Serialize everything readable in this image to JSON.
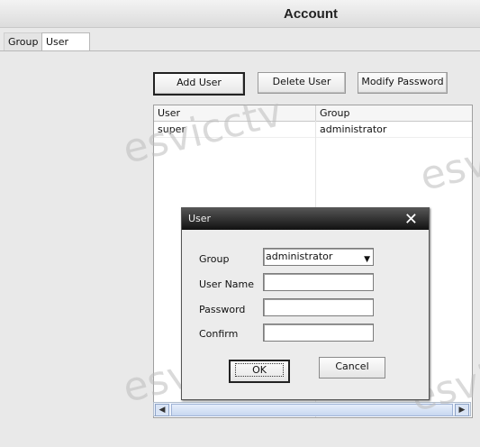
{
  "window": {
    "title": "Account"
  },
  "tabs": [
    {
      "label": "Group"
    },
    {
      "label": "User"
    }
  ],
  "toolbar": {
    "add_user": "Add User",
    "delete_user": "Delete User",
    "modify_password": "Modify Password"
  },
  "table": {
    "headers": [
      "User",
      "Group"
    ],
    "rows": [
      {
        "user": "super",
        "group": "administrator"
      }
    ]
  },
  "watermark": "esvicctv",
  "dialog": {
    "title": "User",
    "fields": {
      "group_label": "Group",
      "group_value": "administrator",
      "username_label": "User Name",
      "username_value": "",
      "password_label": "Password",
      "password_value": "",
      "confirm_label": "Confirm",
      "confirm_value": ""
    },
    "ok": "OK",
    "cancel": "Cancel"
  }
}
